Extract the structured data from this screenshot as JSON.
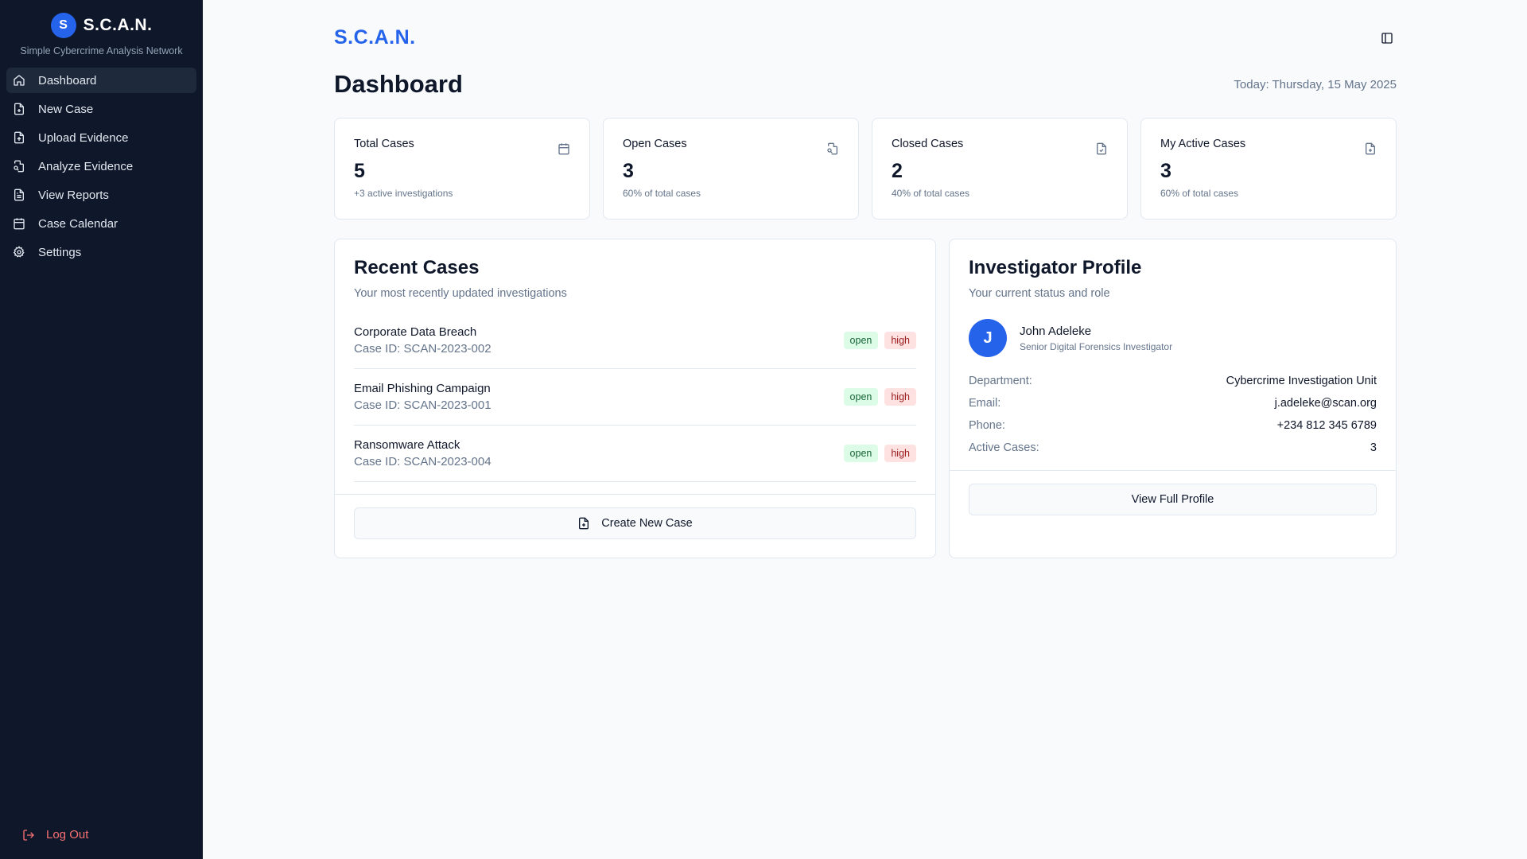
{
  "sidebar": {
    "brand_letter": "S",
    "brand_name": "S.C.A.N.",
    "brand_subtitle": "Simple Cybercrime Analysis Network",
    "items": [
      {
        "label": "Dashboard",
        "icon": "home-icon",
        "active": true
      },
      {
        "label": "New Case",
        "icon": "file-plus-icon"
      },
      {
        "label": "Upload Evidence",
        "icon": "file-upload-icon"
      },
      {
        "label": "Analyze Evidence",
        "icon": "file-search-icon"
      },
      {
        "label": "View Reports",
        "icon": "file-text-icon"
      },
      {
        "label": "Case Calendar",
        "icon": "calendar-icon"
      },
      {
        "label": "Settings",
        "icon": "gear-icon"
      }
    ],
    "logout_label": "Log Out"
  },
  "header": {
    "app_link": "S.C.A.N.",
    "page_title": "Dashboard",
    "today": "Today: Thursday, 15 May 2025"
  },
  "stats": [
    {
      "label": "Total Cases",
      "value": "5",
      "sub": "+3 active investigations",
      "icon": "calendar-icon"
    },
    {
      "label": "Open Cases",
      "value": "3",
      "sub": "60% of total cases",
      "icon": "file-search-icon"
    },
    {
      "label": "Closed Cases",
      "value": "2",
      "sub": "40% of total cases",
      "icon": "file-check-icon"
    },
    {
      "label": "My Active Cases",
      "value": "3",
      "sub": "60% of total cases",
      "icon": "file-plus-icon"
    }
  ],
  "recent": {
    "title": "Recent Cases",
    "subtitle": "Your most recently updated investigations",
    "cases": [
      {
        "name": "Corporate Data Breach",
        "id": "Case ID: SCAN-2023-002",
        "status": "open",
        "priority": "high"
      },
      {
        "name": "Email Phishing Campaign",
        "id": "Case ID: SCAN-2023-001",
        "status": "open",
        "priority": "high"
      },
      {
        "name": "Ransomware Attack",
        "id": "Case ID: SCAN-2023-004",
        "status": "open",
        "priority": "high"
      }
    ],
    "create_label": "Create New Case"
  },
  "profile": {
    "title": "Investigator Profile",
    "subtitle": "Your current status and role",
    "avatar_letter": "J",
    "name": "John Adeleke",
    "role": "Senior Digital Forensics Investigator",
    "info": [
      {
        "key": "Department:",
        "value": "Cybercrime Investigation Unit"
      },
      {
        "key": "Email:",
        "value": "j.adeleke@scan.org"
      },
      {
        "key": "Phone:",
        "value": "+234 812 345 6789"
      },
      {
        "key": "Active Cases:",
        "value": "3"
      }
    ],
    "view_label": "View Full Profile"
  },
  "colors": {
    "accent": "#2563eb",
    "sidebar_bg": "#0f172a",
    "logout": "#f87171",
    "badge_open_bg": "#dcfce7",
    "badge_high_bg": "#fee2e2"
  }
}
